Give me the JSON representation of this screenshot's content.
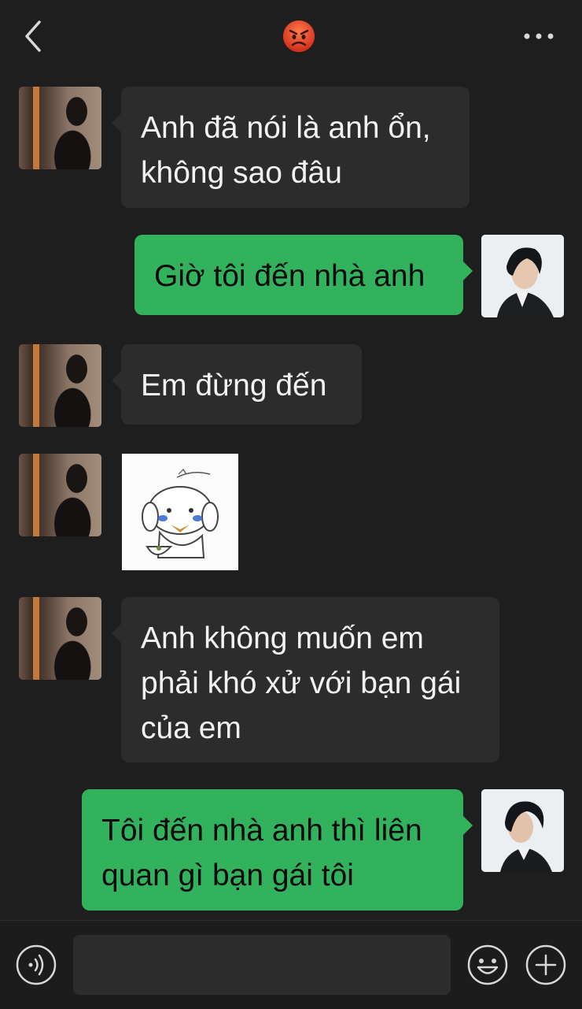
{
  "header": {
    "back_icon": "chevron-left-icon",
    "title_emoji": "😡",
    "more_icon": "more-dots-icon"
  },
  "messages": [
    {
      "from": "them",
      "text": "Anh đã nói là anh ổn, không sao đâu"
    },
    {
      "from": "me",
      "text": "Giờ tôi đến nhà anh"
    },
    {
      "from": "them",
      "text": "Em đừng đến"
    },
    {
      "from": "them",
      "type": "sticker",
      "sticker": "crying-puppy-sticker"
    },
    {
      "from": "them",
      "text": "Anh không muốn em phải khó xử với bạn gái của em"
    },
    {
      "from": "me",
      "text": "Tôi đến nhà anh thì liên quan gì bạn gái tôi"
    }
  ],
  "input_bar": {
    "voice_icon": "voice-icon",
    "text_value": "",
    "emoji_icon": "smiley-icon",
    "plus_icon": "plus-icon"
  },
  "colors": {
    "background": "#1e1e1e",
    "incoming_bubble": "#2c2c2c",
    "outgoing_bubble": "#32b25d"
  }
}
